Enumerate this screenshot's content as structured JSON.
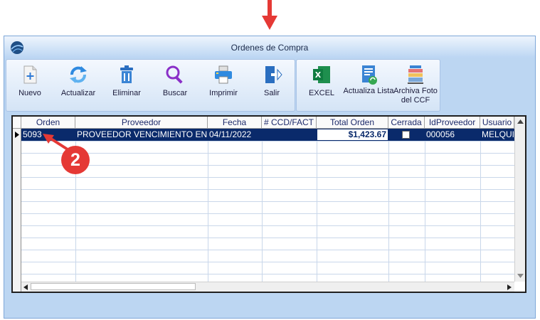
{
  "window": {
    "title": "Ordenes de Compra"
  },
  "toolbar": {
    "group1": [
      {
        "label": "Nuevo",
        "icon": "new-document-icon"
      },
      {
        "label": "Actualizar",
        "icon": "refresh-icon"
      },
      {
        "label": "Eliminar",
        "icon": "trash-icon"
      },
      {
        "label": "Buscar",
        "icon": "search-icon"
      },
      {
        "label": "Imprimir",
        "icon": "printer-icon"
      },
      {
        "label": "Salir",
        "icon": "exit-icon"
      }
    ],
    "group2": [
      {
        "label": "EXCEL",
        "icon": "excel-icon"
      },
      {
        "label": "Actualiza Lista",
        "icon": "update-list-icon"
      },
      {
        "label": "Archiva Foto del CCF",
        "icon": "archive-photo-icon"
      }
    ]
  },
  "grid": {
    "columns": [
      "Orden",
      "Proveedor",
      "Fecha",
      "# CCD/FACT",
      "Total Orden",
      "Cerrada",
      "IdProveedor",
      "Usuario"
    ],
    "rows": [
      {
        "orden": "5093",
        "proveedor": "PROVEEDOR VENCIMIENTO EN",
        "fecha": "04/11/2022",
        "ccd_fact": "",
        "total": "$1,423.67",
        "cerrada": false,
        "idproveedor": "000056",
        "usuario": "MELQUIN"
      }
    ]
  },
  "annotation": {
    "step_number": "2",
    "color": "#e53935"
  },
  "colors": {
    "accent": "#0a2a6b",
    "window_bg": "#bcd6f2",
    "callout": "#e53935"
  }
}
